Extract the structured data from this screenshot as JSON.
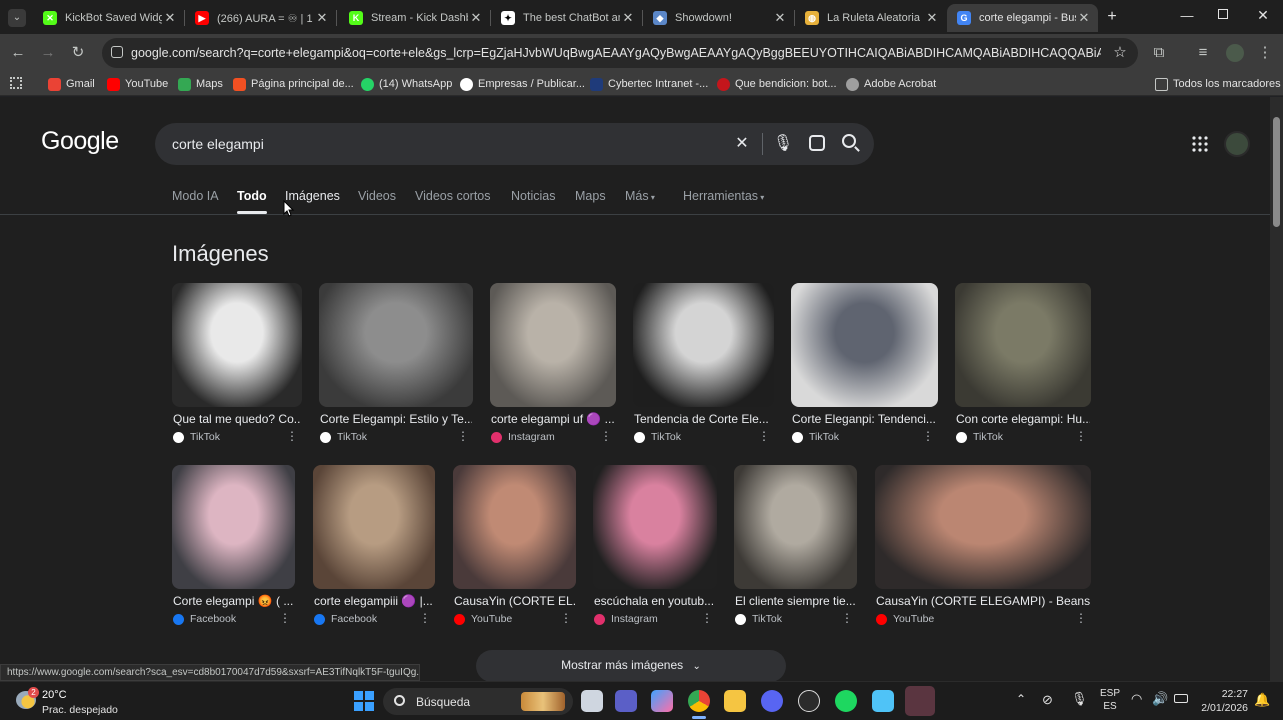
{
  "browser": {
    "tabs": [
      {
        "label": "KickBot Saved Widge",
        "color": "#53fc18",
        "glyph": "✕"
      },
      {
        "label": "(266) AURA = ♾ | 1",
        "color": "#ff0000",
        "glyph": "▶"
      },
      {
        "label": "Stream - Kick Dashbo",
        "color": "#53fc18",
        "glyph": "K"
      },
      {
        "label": "The best ChatBot an",
        "color": "#ffffff",
        "glyph": "✦"
      },
      {
        "label": "Showdown!",
        "color": "#5b87c8",
        "glyph": "◆"
      },
      {
        "label": "La Ruleta Aleatoria",
        "color": "#e7b13b",
        "glyph": "◍"
      },
      {
        "label": "corte elegampi - Bus",
        "color": "#4285f4",
        "glyph": "G",
        "active": true
      }
    ],
    "new_tab_icon": "plus-icon",
    "url": "google.com/search?q=corte+elegampi&oq=corte+ele&gs_lcrp=EgZjaHJvbWUqBwgAEAAYgAQyBwgAEAAYgAQyBggBEEUYOTIHCAIQABiABDIHCAMQABiABDIHCAQQABiABDIHCAUQABi...",
    "bookmarks": [
      {
        "label": "Gmail",
        "color": "#ea4335"
      },
      {
        "label": "YouTube",
        "color": "#ff0000"
      },
      {
        "label": "Maps",
        "color": "#34a853"
      },
      {
        "label": "Página principal de...",
        "color": "#f25022"
      },
      {
        "label": "(14) WhatsApp",
        "color": "#25d366"
      },
      {
        "label": "Empresas / Publicar...",
        "color": "#ffffff"
      },
      {
        "label": "Cybertec Intranet -...",
        "color": "#1f3b7a"
      },
      {
        "label": "Que bendicion: bot...",
        "color": "#c4161c"
      },
      {
        "label": "Adobe Acrobat",
        "color": "#9e9e9e"
      }
    ],
    "all_bookmarks": "Todos los marcadores"
  },
  "google": {
    "logo": "Google",
    "query": "corte elegampi",
    "nav": [
      "Modo IA",
      "Todo",
      "Imágenes",
      "Videos",
      "Videos cortos",
      "Noticias",
      "Maps",
      "Más",
      "Herramientas"
    ],
    "images_heading": "Imágenes",
    "row1": [
      {
        "title": "Que tal me quedo? Co...",
        "source": "TikTok",
        "src_color": "#ffffff",
        "c1": "#e9e9e9",
        "c2": "#2a2a2a"
      },
      {
        "title": "Corte Elegampi: Estilo y Te...",
        "source": "TikTok",
        "src_color": "#ffffff",
        "c1": "#8d8d8d",
        "c2": "#3b3b3b"
      },
      {
        "title": "corte elegampi uf 🟣 ...",
        "source": "Instagram",
        "src_color": "#e1306c",
        "c1": "#b9b2a8",
        "c2": "#5d5a56"
      },
      {
        "title": "Tendencia de Corte Ele...",
        "source": "TikTok",
        "src_color": "#ffffff",
        "c1": "#d4d4d4",
        "c2": "#1e1e1e"
      },
      {
        "title": "Corte Eleganpi: Tendenci...",
        "source": "TikTok",
        "src_color": "#ffffff",
        "c1": "#5f6470",
        "c2": "#d9d9d9"
      },
      {
        "title": "Con corte elegampi: Hu...",
        "source": "TikTok",
        "src_color": "#ffffff",
        "c1": "#7b7a66",
        "c2": "#3b3a33"
      }
    ],
    "row2": [
      {
        "title": "Corte elegampi 😡 ( ...",
        "source": "Facebook",
        "src_color": "#1877f2",
        "c1": "#ddb5c2",
        "c2": "#3f3f45"
      },
      {
        "title": "corte elegampiii 🟣 |...",
        "source": "Facebook",
        "src_color": "#1877f2",
        "c1": "#b79c82",
        "c2": "#5a4538"
      },
      {
        "title": "CausaYin (CORTE EL...",
        "source": "YouTube",
        "src_color": "#ff0000",
        "c1": "#c08a74",
        "c2": "#4a3a3a"
      },
      {
        "title": "escúchala en youtub...",
        "source": "Instagram",
        "src_color": "#e1306c",
        "c1": "#d9819f",
        "c2": "#202020"
      },
      {
        "title": "El cliente siempre tie...",
        "source": "TikTok",
        "src_color": "#ffffff",
        "c1": "#b0aaa0",
        "c2": "#3d3a36"
      },
      {
        "title": "CausaYin (CORTE ELEGAMPI) - Beans...",
        "source": "YouTube",
        "src_color": "#ff0000",
        "c1": "#bb8672",
        "c2": "#2e2a2a"
      }
    ],
    "more_images": "Mostrar más imágenes",
    "status_url": "https://www.google.com/search?sca_esv=cd8b0170047d7d59&sxsrf=AE3TifNqlkT5F-tguIQg..."
  },
  "taskbar": {
    "weather_temp": "20°C",
    "weather_desc": "Prac. despejado",
    "weather_badge": "2",
    "search_label": "Búsqueda",
    "lang1": "ESP",
    "lang2": "ES",
    "time": "22:27",
    "date": "2/01/2026"
  }
}
